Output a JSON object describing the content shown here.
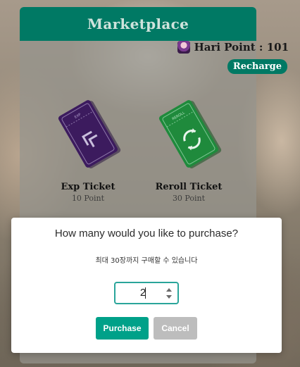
{
  "marketplace": {
    "title": "Marketplace",
    "points_label": "Hari Point : 101",
    "recharge_label": "Recharge",
    "tickets": [
      {
        "name": "Exp Ticket",
        "cost": "10 Point",
        "color": "#3c1b5e",
        "icon": "exp-ticket-icon",
        "stub_text": "EXP"
      },
      {
        "name": "Reroll Ticket",
        "cost": "30 Point",
        "color": "#1f8a3c",
        "icon": "reroll-ticket-icon",
        "stub_text": "REROLL"
      }
    ]
  },
  "dialog": {
    "title": "How many would you like to purchase?",
    "subtitle": "최대 30장까지 구매할 수 있습니다",
    "quantity": "2",
    "purchase_label": "Purchase",
    "cancel_label": "Cancel"
  },
  "colors": {
    "brand": "#007964",
    "purchase": "#00a189",
    "cancel": "#bdbdbd"
  }
}
